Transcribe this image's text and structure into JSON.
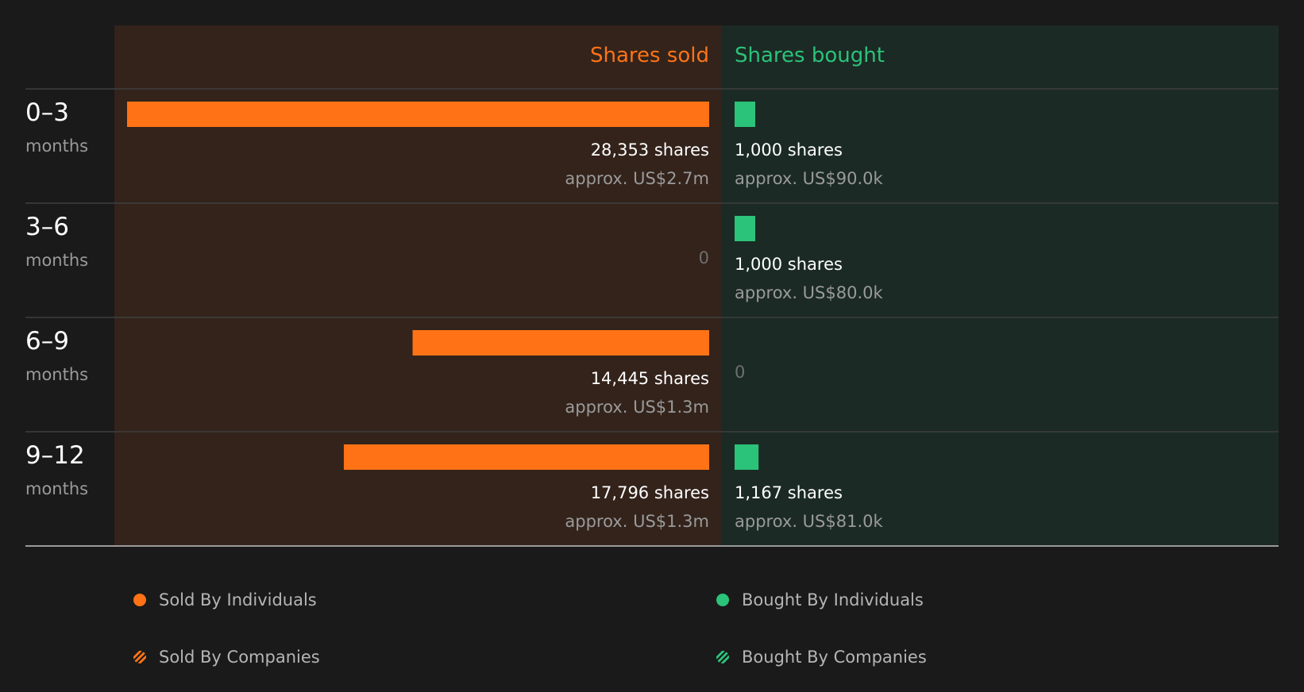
{
  "colors": {
    "page_bg": "#1a1a1a",
    "sold_panel": "#33231b",
    "bought_panel": "#1b2a24",
    "sold": "#ff7316",
    "bought": "#2bc27a",
    "primary_text": "#ffffff",
    "secondary_text": "#9a9a9a",
    "zero_text": "#6f6f6f"
  },
  "chart_data": {
    "type": "bar",
    "orientation": "horizontal-diverging",
    "headers": {
      "sold": "Shares sold",
      "bought": "Shares bought"
    },
    "periods": [
      {
        "range": "0–3",
        "unit": "months",
        "sold_shares": 28353,
        "sold_label": "28,353 shares",
        "sold_value": "approx. US$2.7m",
        "bought_shares": 1000,
        "bought_label": "1,000 shares",
        "bought_value": "approx. US$90.0k"
      },
      {
        "range": "3–6",
        "unit": "months",
        "sold_shares": 0,
        "sold_label": "0",
        "sold_value": "",
        "bought_shares": 1000,
        "bought_label": "1,000 shares",
        "bought_value": "approx. US$80.0k"
      },
      {
        "range": "6–9",
        "unit": "months",
        "sold_shares": 14445,
        "sold_label": "14,445 shares",
        "sold_value": "approx. US$1.3m",
        "bought_shares": 0,
        "bought_label": "0",
        "bought_value": ""
      },
      {
        "range": "9–12",
        "unit": "months",
        "sold_shares": 17796,
        "sold_label": "17,796 shares",
        "sold_value": "approx. US$1.3m",
        "bought_shares": 1167,
        "bought_label": "1,167 shares",
        "bought_value": "approx. US$81.0k"
      }
    ],
    "xlim": [
      0,
      28353
    ],
    "grid": false
  },
  "legend": {
    "sold_individuals": "Sold By Individuals",
    "bought_individuals": "Bought By Individuals",
    "sold_companies": "Sold By Companies",
    "bought_companies": "Bought By Companies"
  }
}
